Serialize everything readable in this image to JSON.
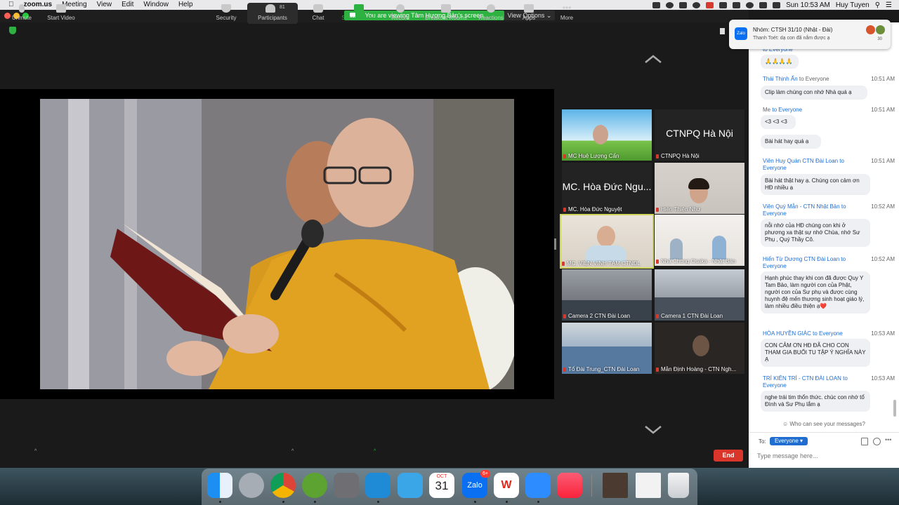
{
  "menubar": {
    "app_name": "zoom.us",
    "items": [
      "Meeting",
      "View",
      "Edit",
      "Window",
      "Help"
    ],
    "clock": "Sun 10:53 AM",
    "user": "Huy Tuyen"
  },
  "banner": {
    "text": "You are viewing Tâm Hương Bản's screen",
    "view_options": "View Options ⌄"
  },
  "gallery": [
    {
      "name": "MC Huệ Lượng Cẩn",
      "big_text": ""
    },
    {
      "name": "CTNPQ Hà Nội",
      "big_text": "CTNPQ Hà Nội"
    },
    {
      "name": "MC. Hòa Đức Nguyệt",
      "big_text": "MC. Hòa Đức Ngu..."
    },
    {
      "name": "Hiền Thiện Như",
      "big_text": ""
    },
    {
      "name": "MC. VIÊN VINH TÂM CTNĐL",
      "big_text": ""
    },
    {
      "name": "Nhà Chung Osaka - Nhật Bản",
      "big_text": ""
    },
    {
      "name": "Camera 2 CTN Đài Loan",
      "big_text": ""
    },
    {
      "name": "Camera 1 CTN Đài Loan",
      "big_text": ""
    },
    {
      "name": "Tổ Đài Trung_CTN Đài Loan",
      "big_text": ""
    },
    {
      "name": "Mẫn Định Hoàng - CTN Ngh...",
      "big_text": ""
    }
  ],
  "toolbar": {
    "unmute": "Unmute",
    "start_video": "Start Video",
    "security": "Security",
    "participants": "Participants",
    "participants_count": "81",
    "chat": "Chat",
    "share_screen": "Share Screen",
    "record": "Record",
    "breakout_rooms": "Breakout Rooms",
    "reactions": "Reactions",
    "apps": "Apps",
    "more": "More",
    "end": "End"
  },
  "notification": {
    "app": "Zalo",
    "title": "Nhóm: CTSH 31/10 (Nhật - Đài)",
    "body": "Thanh Toét: dạ con đã nắm được ạ",
    "count": "30"
  },
  "chat": {
    "messages": [
      {
        "sender": "",
        "to": "to Everyone",
        "time": "",
        "text": "🙏🙏🙏🙏"
      },
      {
        "sender": "Thái Thịnh Ấn",
        "to": " to Everyone",
        "time": "10:51 AM",
        "text": "Clip làm chúng con nhớ Nhà quá ạ"
      },
      {
        "sender": "Me",
        "to": " to Everyone",
        "time": "10:51 AM",
        "text": "<3 <3 <3"
      },
      {
        "sender": "",
        "to": "",
        "time": "",
        "text": "Bài hát hay quá ạ"
      },
      {
        "sender": "Viên Huy Quán CTN Đài Loan",
        "to": " to Everyone",
        "time": "10:51 AM",
        "text": "Bài hát thật hay ạ. Chúng con  cảm ơn HĐ  nhiều  ạ"
      },
      {
        "sender": "Viên Quý Mẫn - CTN Nhật Bản",
        "to": " to Everyone",
        "time": "10:52 AM",
        "text": "nỗi nhớ của HĐ chúng con khi ở phương xa thật sự nhớ Chùa, nhớ Sư Phụ , Quý Thầy Cô."
      },
      {
        "sender": "Hiển Từ Dương CTN Đài Loan",
        "to": " to Everyone",
        "time": "10:52 AM",
        "text": "Hạnh phúc thay khi con đã được Quy Y Tam Bảo, làm người con của Phật, người con của Sư phụ và được cùng huynh đệ mến thương sinh hoạt giáo lý, làm nhiều điều thiện ạ❤️"
      },
      {
        "sender": "HÒA HUYỀN GIÁC",
        "to": " to Everyone",
        "time": "10:53 AM",
        "text": "CON CẢM ƠN HĐ ĐÃ CHO CON THAM GIA BUỔI TU TẬP Ý NGHĨA NÀY Ạ"
      },
      {
        "sender": "TRÍ KIÊN TRÍ - CTN ĐÀI LOAN",
        "to": " to Everyone",
        "time": "10:53 AM",
        "text": "nghe trái tim thổn thức. chúc con nhớ tổ Đình và Sư Phụ lắm ạ"
      }
    ],
    "who_can_see": "Who can see your messages?",
    "to_label": "To:",
    "to_value": "Everyone ▾",
    "input_placeholder": "Type message here..."
  },
  "dock": {
    "calendar_month": "OCT",
    "calendar_day": "31",
    "zalo_label": "Zalo",
    "zalo_badge": "6+"
  },
  "colors": {
    "share_green": "#2db140",
    "end_red": "#d9352b",
    "chat_link": "#1f6dd1"
  }
}
